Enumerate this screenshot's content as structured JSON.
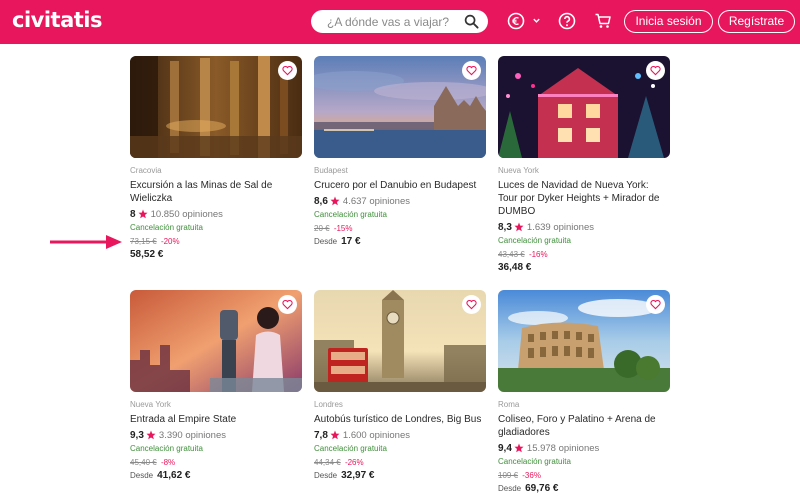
{
  "header": {
    "logo": "civitatis",
    "search_placeholder": "¿A dónde vas a viajar?",
    "login_label": "Inicia sesión",
    "register_label": "Regístrate",
    "icons": [
      "currency-euro-icon",
      "chevron-down-icon",
      "help-icon",
      "cart-icon"
    ]
  },
  "colors": {
    "brand": "#e8175d",
    "cancel": "#3f8f3a",
    "discount": "#e8175d"
  },
  "cards": [
    {
      "city": "Cracovia",
      "title": "Excursión a las Minas de Sal de Wieliczka",
      "score": "8",
      "opinions": "10.850 opiniones",
      "cancel": "Cancelación gratuita",
      "old_price": "73,15 €",
      "discount": "-20%",
      "desde": "",
      "price": "58,52 €"
    },
    {
      "city": "Budapest",
      "title": "Crucero por el Danubio en Budapest",
      "score": "8,6",
      "opinions": "4.637 opiniones",
      "cancel": "Cancelación gratuita",
      "old_price": "20 €",
      "discount": "-15%",
      "desde": "Desde",
      "price": "17 €"
    },
    {
      "city": "Nueva York",
      "title": "Luces de Navidad de Nueva York: Tour por Dyker Heights + Mirador de DUMBO",
      "score": "8,3",
      "opinions": "1.639 opiniones",
      "cancel": "Cancelación gratuita",
      "old_price": "43,43 €",
      "discount": "-16%",
      "desde": "",
      "price": "36,48 €"
    },
    {
      "city": "Nueva York",
      "title": "Entrada al Empire State",
      "score": "9,3",
      "opinions": "3.390 opiniones",
      "cancel": "Cancelación gratuita",
      "old_price": "45,40 €",
      "discount": "-8%",
      "desde": "Desde",
      "price": "41,62 €"
    },
    {
      "city": "Londres",
      "title": "Autobús turístico de Londres, Big Bus",
      "score": "7,8",
      "opinions": "1.600 opiniones",
      "cancel": "Cancelación gratuita",
      "old_price": "44,34 €",
      "discount": "-26%",
      "desde": "Desde",
      "price": "32,97 €"
    },
    {
      "city": "Roma",
      "title": "Coliseo, Foro y Palatino + Arena de gladiadores",
      "score": "9,4",
      "opinions": "15.978 opiniones",
      "cancel": "Cancelación gratuita",
      "old_price": "109 €",
      "discount": "-36%",
      "desde": "Desde",
      "price": "69,76 €"
    }
  ]
}
